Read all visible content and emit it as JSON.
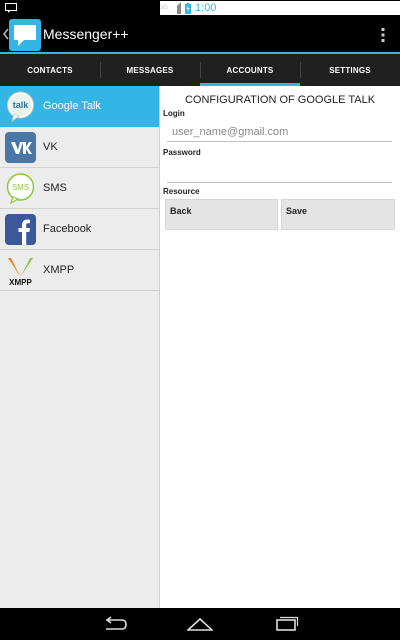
{
  "status_bar": {
    "time": "1:00",
    "network": "3G"
  },
  "app": {
    "title": "Messenger++"
  },
  "tabs": [
    "CONTACTS",
    "MESSAGES",
    "ACCOUNTS",
    "SETTINGS"
  ],
  "active_tab": "ACCOUNTS",
  "accounts": [
    {
      "label": "Google Talk",
      "icon": "google-talk-icon"
    },
    {
      "label": "VK",
      "icon": "vk-icon"
    },
    {
      "label": "SMS",
      "icon": "sms-icon"
    },
    {
      "label": "Facebook",
      "icon": "facebook-icon"
    },
    {
      "label": "XMPP",
      "icon": "xmpp-icon"
    }
  ],
  "config": {
    "title": "CONFIGURATION OF GOOGLE TALK",
    "login_label": "Login",
    "login_placeholder": "user_name@gmail.com",
    "password_label": "Password",
    "resource_label": "Resource",
    "back_label": "Back",
    "save_label": "Save"
  },
  "icons": {
    "logo_text": "talk",
    "sms_text": "SMS",
    "xmpp_text": "XMPP"
  },
  "colors": {
    "accent": "#33b5e5",
    "vk": "#4a76a8",
    "facebook": "#3b5998",
    "sms": "#8cc63f"
  }
}
